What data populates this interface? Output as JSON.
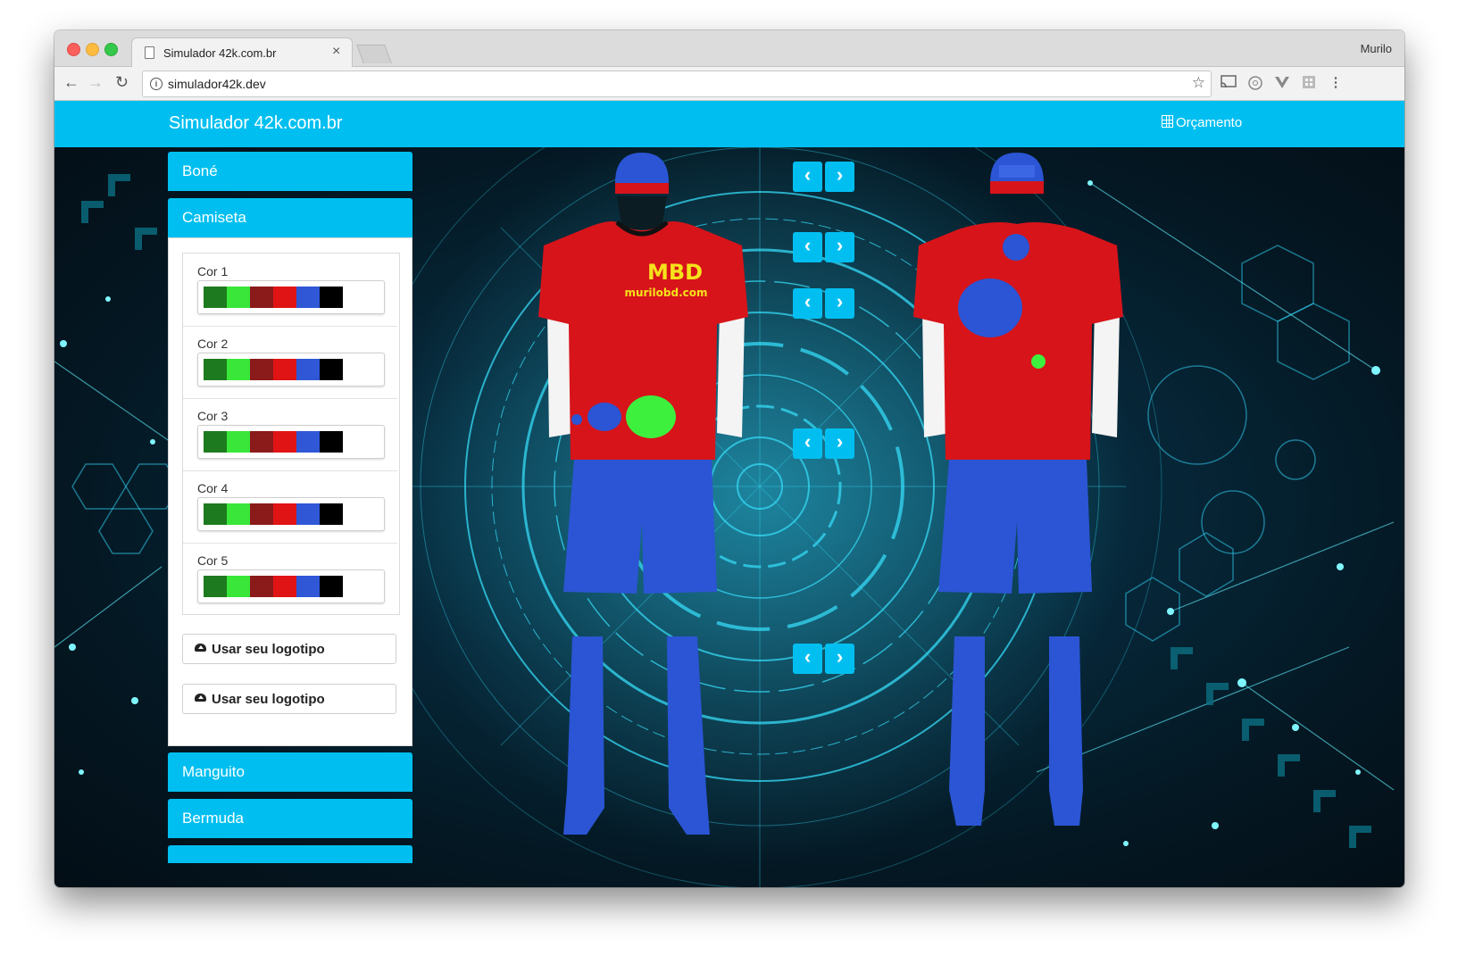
{
  "browser": {
    "tab_title": "Simulador 42k.com.br",
    "tab_close": "×",
    "url": "simulador42k.dev",
    "profile_name": "Murilo",
    "nav": {
      "back": "←",
      "forward": "→",
      "reload": "↻"
    },
    "bookmark_icon": "☆",
    "menu_icon": "⋮"
  },
  "navbar": {
    "brand": "Simulador 42k.com.br",
    "budget_label": "Orçamento"
  },
  "sidebar": {
    "sections": [
      "Boné",
      "Camiseta",
      "Manguito",
      "Bermuda"
    ],
    "colors": [
      {
        "label": "Cor 1"
      },
      {
        "label": "Cor 2"
      },
      {
        "label": "Cor 3"
      },
      {
        "label": "Cor 4"
      },
      {
        "label": "Cor 5"
      }
    ],
    "swatches": [
      "#1e7a1e",
      "#39e639",
      "#8b1a1a",
      "#e01414",
      "#2f57d6",
      "#000000"
    ],
    "logo_buttons": [
      "Usar seu logotipo",
      "Usar seu logotipo"
    ]
  },
  "controls": {
    "prev": "‹",
    "next": "›"
  },
  "kit": {
    "logo_text": "MBD",
    "site_text": "murilobd.com",
    "colors": {
      "shirt": "#d7141a",
      "shorts": "#2b55d4",
      "sleeves": "#f4f4f4",
      "cap": "#2b55d4",
      "logo": "#f5e21b",
      "accent_green": "#3ef03e"
    }
  }
}
